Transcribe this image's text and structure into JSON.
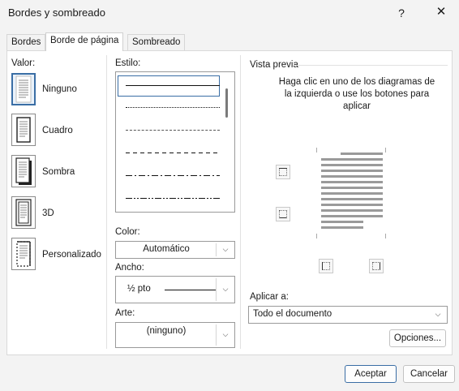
{
  "window": {
    "title": "Bordes y sombreado",
    "help_label": "?",
    "close_label": "✕"
  },
  "tabs": [
    {
      "label": "Bordes",
      "active": false
    },
    {
      "label": "Borde de página",
      "active": true
    },
    {
      "label": "Sombreado",
      "active": false
    }
  ],
  "valor": {
    "label": "Valor:",
    "items": [
      {
        "label": "Ninguno",
        "icon": "page-none-icon",
        "selected": true
      },
      {
        "label": "Cuadro",
        "icon": "page-box-icon",
        "selected": false
      },
      {
        "label": "Sombra",
        "icon": "page-shadow-icon",
        "selected": false
      },
      {
        "label": "3D",
        "icon": "page-3d-icon",
        "selected": false
      },
      {
        "label": "Personalizado",
        "icon": "page-custom-icon",
        "selected": false
      }
    ]
  },
  "estilo": {
    "label": "Estilo:",
    "styles": [
      "solid",
      "dotted",
      "dashed-fine",
      "dashed",
      "dash-dot",
      "dash-dot-dot"
    ]
  },
  "color": {
    "label": "Color:",
    "value": "Automático"
  },
  "ancho": {
    "label": "Ancho:",
    "value": "½ pto"
  },
  "arte": {
    "label": "Arte:",
    "value": "(ninguno)"
  },
  "preview": {
    "title": "Vista previa",
    "help_text": "Haga clic en uno de los diagramas de la izquierda o use los botones para aplicar"
  },
  "aplicar": {
    "label": "Aplicar a:",
    "value": "Todo el documento"
  },
  "buttons": {
    "options": "Opciones...",
    "accept": "Aceptar",
    "cancel": "Cancelar"
  },
  "colors": {
    "accent": "#3a6ea5",
    "background": "#f3f3f3"
  }
}
